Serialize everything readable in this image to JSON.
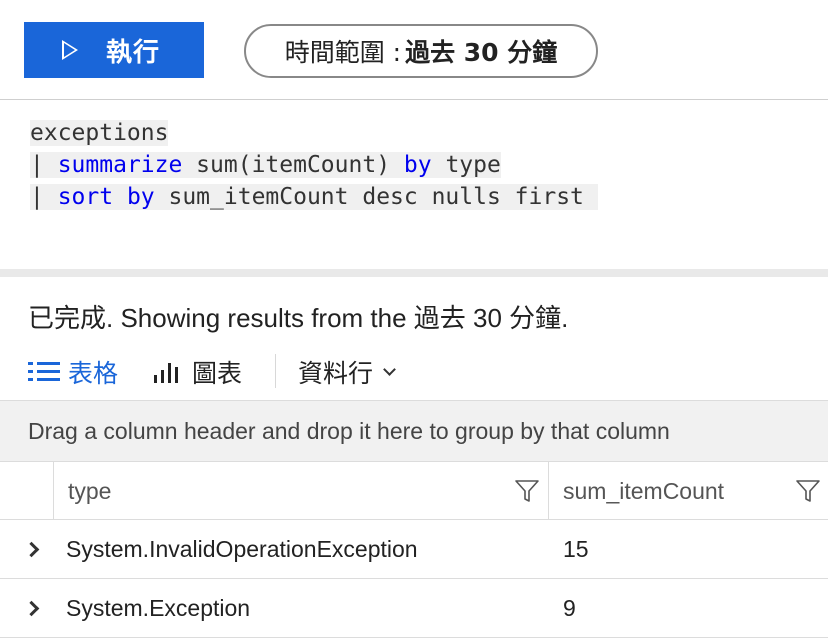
{
  "toolbar": {
    "run_label": "執行",
    "time_range_prefix": "時間範圍 :",
    "time_range_value": "過去 30 分鐘"
  },
  "editor": {
    "lines": [
      {
        "text": "exceptions"
      },
      {
        "pipe": "| ",
        "kw1": "summarize",
        "mid": " sum(itemCount) ",
        "kw2": "by",
        "rest": " type"
      },
      {
        "pipe": "| ",
        "kw1": "sort by",
        "rest": " sum_itemCount desc nulls first "
      }
    ],
    "keyword_color": "#0000ee"
  },
  "results": {
    "status": "已完成. Showing results from the 過去 30 分鐘.",
    "tabs": {
      "table": "表格",
      "chart": "圖表",
      "columns": "資料行"
    },
    "group_hint": "Drag a column header and drop it here to group by that column",
    "columns": [
      "type",
      "sum_itemCount"
    ],
    "rows": [
      {
        "type": "System.InvalidOperationException",
        "sum_itemCount": "15"
      },
      {
        "type": "System.Exception",
        "sum_itemCount": "9"
      }
    ]
  },
  "colors": {
    "accent": "#1a66d9"
  }
}
